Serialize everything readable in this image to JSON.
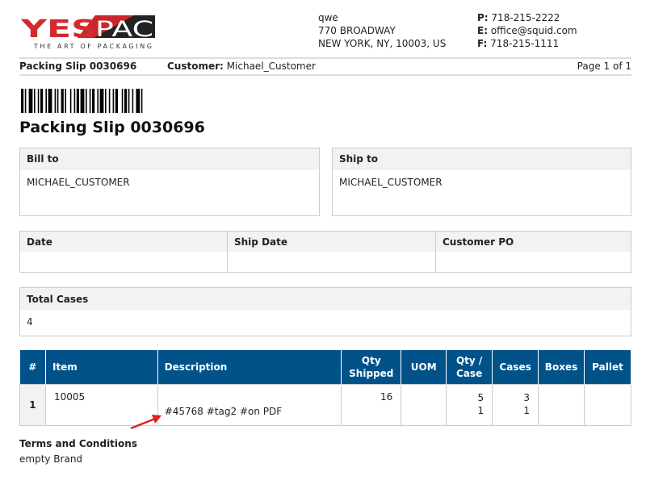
{
  "logo": {
    "text_left": "YES",
    "text_right": "PAC",
    "tagline": "THE ART OF PACKAGING"
  },
  "company": {
    "name": "qwe",
    "street": "770 BROADWAY",
    "city": "NEW YORK, NY, 10003, US"
  },
  "contact": {
    "phone_label": "P:",
    "phone": "718-215-2222",
    "email_label": "E:",
    "email": "office@squid.com",
    "fax_label": "F:",
    "fax": "718-215-1111"
  },
  "strip": {
    "slip": "Packing Slip 0030696",
    "customer_label": "Customer:",
    "customer": "Michael_Customer",
    "page": "Page 1 of 1"
  },
  "title": "Packing Slip 0030696",
  "bill_to": {
    "label": "Bill to",
    "value": "MICHAEL_CUSTOMER"
  },
  "ship_to": {
    "label": "Ship to",
    "value": "MICHAEL_CUSTOMER"
  },
  "dates": {
    "date_label": "Date",
    "date": "",
    "ship_date_label": "Ship Date",
    "ship_date": "",
    "po_label": "Customer PO",
    "po": ""
  },
  "total_cases": {
    "label": "Total Cases",
    "value": "4"
  },
  "table": {
    "headers": [
      "#",
      "Item",
      "Description",
      "Qty Shipped",
      "UOM",
      "Qty / Case",
      "Cases",
      "Boxes",
      "Pallet"
    ],
    "rows": [
      {
        "n": "1",
        "item": "10005",
        "description": "#45768 #tag2 #on PDF",
        "qty_shipped": "16",
        "uom": "",
        "qty_case_1": "5",
        "qty_case_2": "1",
        "cases_1": "3",
        "cases_2": "1",
        "boxes": "",
        "pallet": ""
      }
    ]
  },
  "terms": {
    "label": "Terms and Conditions",
    "value": "empty Brand"
  },
  "colors": {
    "header": "#02528a",
    "logo_red": "#d12a2f",
    "arrow": "#e02020"
  }
}
